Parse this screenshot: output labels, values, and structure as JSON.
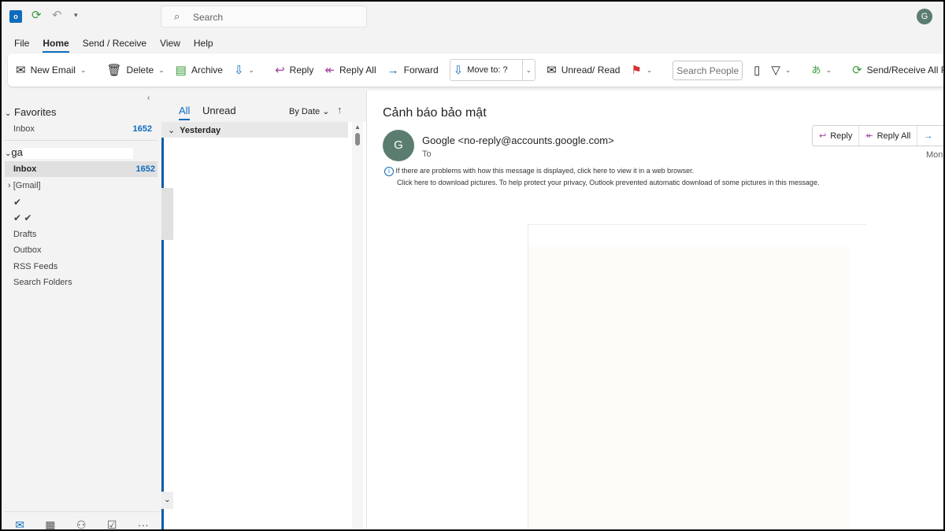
{
  "titlebar": {
    "search_placeholder": "Search",
    "avatar": "G"
  },
  "menu_tabs": [
    "File",
    "Home",
    "Send / Receive",
    "View",
    "Help"
  ],
  "ribbon": {
    "new_email": "New Email",
    "delete": "Delete",
    "archive": "Archive",
    "reply": "Reply",
    "reply_all": "Reply All",
    "forward": "Forward",
    "move_to": "Move to: ?",
    "unread_read": "Unread/ Read",
    "search_people_placeholder": "Search People",
    "send_receive_all": "Send/Receive All F"
  },
  "folders": {
    "favorites": "Favorites",
    "fav_inbox": "Inbox",
    "fav_inbox_count": "1652",
    "account": "ga",
    "inbox": "Inbox",
    "inbox_count": "1652",
    "gmail": "[Gmail]",
    "check1": "✔",
    "check2": "✔ ✔",
    "drafts": "Drafts",
    "outbox": "Outbox",
    "rss": "RSS Feeds",
    "search_folders": "Search Folders"
  },
  "list": {
    "tab_all": "All",
    "tab_unread": "Unread",
    "sort": "By Date",
    "group": "Yesterday"
  },
  "message": {
    "subject": "Cảnh báo bảo mật",
    "avatar": "G",
    "from": "Google <no-reply@accounts.google.com>",
    "to_label": "To",
    "date": "Mon",
    "reply": "Reply",
    "reply_all": "Reply All",
    "info1": "If there are problems with how this message is displayed, click here to view it in a web browser.",
    "info2": "Click here to download pictures. To help protect your privacy, Outlook prevented automatic download of some pictures in this message."
  },
  "colors": {
    "accent": "#0f6cbd",
    "avatar": "#5a7d70"
  }
}
